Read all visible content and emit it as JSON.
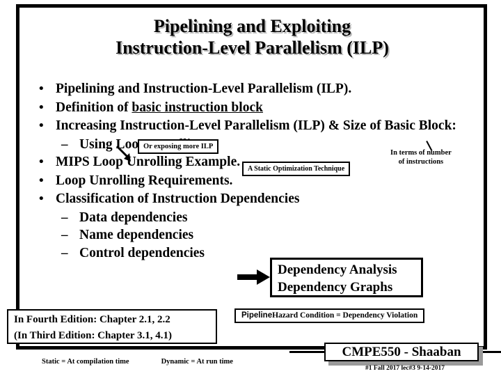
{
  "slide": {
    "title_lines": [
      "Pipelining and Exploiting",
      "Instruction-Level Parallelism (ILP)"
    ],
    "bullets": [
      {
        "marker": "•",
        "level": 1,
        "text": "Pipelining and Instruction-Level Parallelism (ILP)."
      },
      {
        "marker": "•",
        "level": 1,
        "text_pre": "Definition of ",
        "text_underline": "basic instruction block"
      },
      {
        "marker": "•",
        "level": 1,
        "text": "Increasing Instruction-Level Parallelism (ILP) & Size of Basic Block:"
      },
      {
        "marker": "–",
        "level": 2,
        "text": "Using Loop Unrolling"
      },
      {
        "marker": "•",
        "level": 1,
        "text": "MIPS Loop Unrolling Example."
      },
      {
        "marker": "•",
        "level": 1,
        "text": "Loop Unrolling Requirements."
      },
      {
        "marker": "•",
        "level": 1,
        "text": "Classification of Instruction Dependencies"
      },
      {
        "marker": "–",
        "level": 2,
        "text": "Data dependencies"
      },
      {
        "marker": "–",
        "level": 2,
        "text": "Name dependencies"
      },
      {
        "marker": "–",
        "level": 2,
        "text": "Control dependencies"
      }
    ],
    "callouts": {
      "exposing_ilp": "Or exposing more ILP",
      "static_optimization": "A Static Optimization Technique",
      "hazard_prefix": "Pipeline",
      "hazard_rest": "Hazard Condition = Dependency Violation"
    },
    "notes": {
      "in_terms_line1": "In terms of number",
      "in_terms_line2": "of instructions"
    },
    "dependency_box": {
      "line1": "Dependency Analysis",
      "line2": "Dependency Graphs"
    },
    "edition_box": {
      "line1": "In Fourth Edition:  Chapter 2.1, 2.2",
      "line2": "(In Third Edition:  Chapter 3.1, 4.1)"
    },
    "footer": {
      "static_def": "Static = At compilation time",
      "dynamic_def": "Dynamic =  At run time",
      "course_plate": "CMPE550 - Shaaban",
      "plate_sub": "#1  Fall 2017   lec#3  9-14-2017"
    },
    "colors": {
      "ink": "#000000",
      "paper": "#ffffff",
      "title_shadow": "#b8b8b8",
      "plate_shadow": "#9a9a9a"
    }
  }
}
